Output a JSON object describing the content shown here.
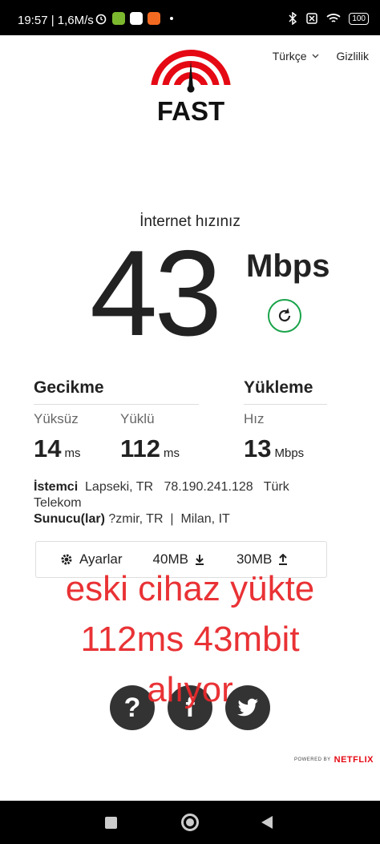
{
  "status_bar": {
    "time": "19:57",
    "network_speed": "1,6M/s",
    "battery": "100"
  },
  "nav": {
    "language": "Türkçe",
    "privacy": "Gizlilik"
  },
  "logo": {
    "text": "FAST",
    "color": "#e50914"
  },
  "speed": {
    "title": "İnternet hızınız",
    "value": "43",
    "unit": "Mbps"
  },
  "latency": {
    "title": "Gecikme",
    "unloaded_label": "Yüksüz",
    "unloaded_value": "14",
    "unloaded_unit": "ms",
    "loaded_label": "Yüklü",
    "loaded_value": "112",
    "loaded_unit": "ms"
  },
  "upload": {
    "title": "Yükleme",
    "speed_label": "Hız",
    "speed_value": "13",
    "speed_unit": "Mbps"
  },
  "client": {
    "label": "İstemci",
    "value": "Lapseki, TR   78.190.241.128   Türk Telekom"
  },
  "servers": {
    "label": "Sunucu(lar)",
    "value": "?zmir, TR  |  Milan, IT"
  },
  "settings_bar": {
    "settings": "Ayarlar",
    "download_size": "40MB",
    "upload_size": "30MB"
  },
  "overlay": {
    "line1": "eski cihaz yükte",
    "line2": "112ms 43mbit",
    "line3": "alıyor"
  },
  "footer": {
    "powered_by": "POWERED BY",
    "brand": "NETFLIX"
  },
  "colors": {
    "accent_green": "#1aa34a",
    "overlay_red": "#e8282b",
    "netflix_red": "#e50914"
  }
}
